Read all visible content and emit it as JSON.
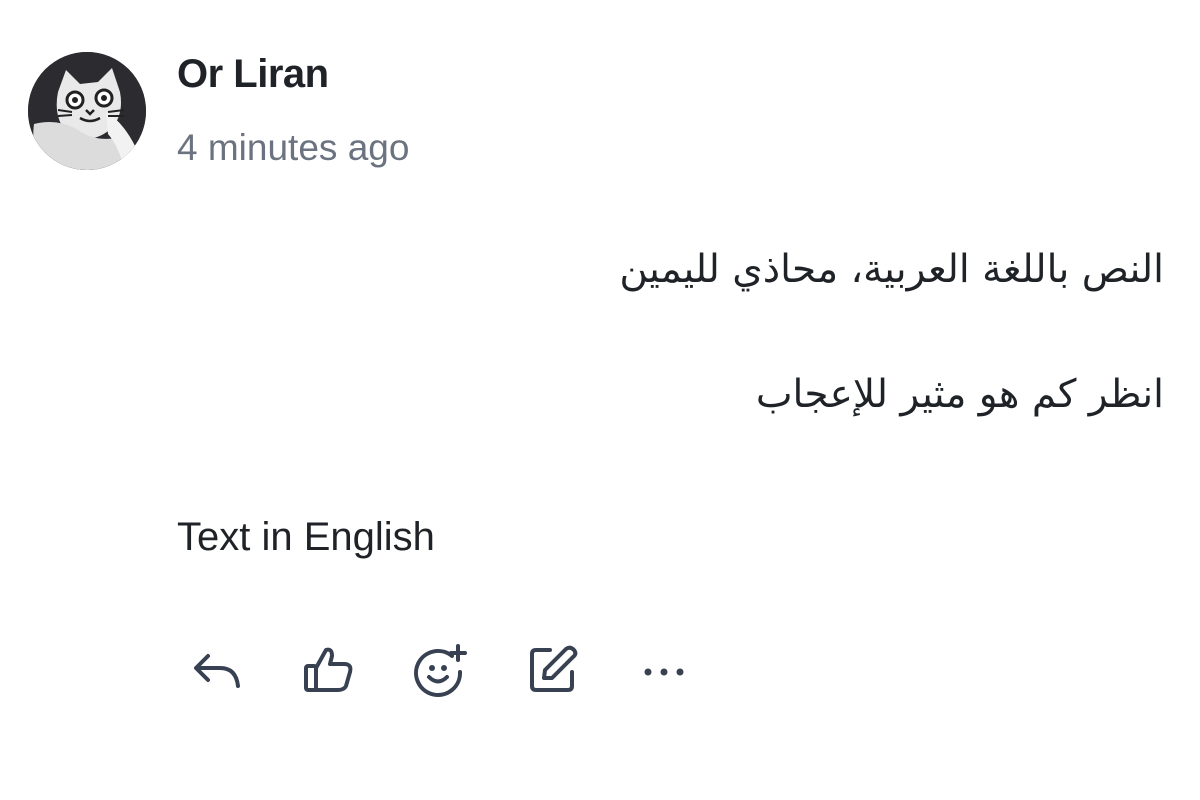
{
  "comment": {
    "author": "Or Liran",
    "timestamp": "4 minutes ago",
    "paragraphs": {
      "arabic_1": "النص باللغة العربية، محاذي لليمين",
      "arabic_2": "انظر كم هو مثير للإعجاب",
      "english": "Text in English"
    },
    "avatar_icon": "cat-avatar-icon"
  },
  "actions": [
    {
      "icon": "reply-icon"
    },
    {
      "icon": "thumbs-up-icon"
    },
    {
      "icon": "add-reaction-icon"
    },
    {
      "icon": "edit-icon"
    },
    {
      "icon": "more-options-icon"
    }
  ],
  "colors": {
    "text_primary": "#1f2328",
    "text_secondary": "#6b7280",
    "icon": "#374151"
  }
}
